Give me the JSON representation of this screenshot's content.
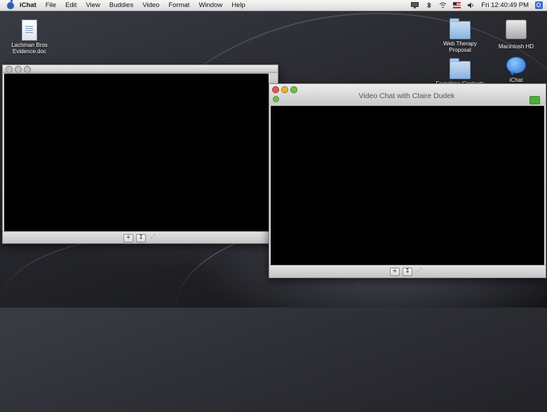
{
  "menubar": {
    "app_name": "iChat",
    "items": [
      "File",
      "Edit",
      "View",
      "Buddies",
      "Video",
      "Format",
      "Window",
      "Help"
    ],
    "clock": "Fri 12:40:49 PM"
  },
  "desktop": {
    "icons": [
      {
        "label": "Lachman Bros Evidence.doc",
        "icon": "document-icon"
      },
      {
        "label": "Web Therapy Proposal",
        "icon": "folder-icon"
      },
      {
        "label": "Macintosh HD",
        "icon": "hard-drive-icon"
      },
      {
        "label": "Franchise Contacts",
        "icon": "folder-icon"
      },
      {
        "label": "iChat",
        "icon": "ichat-icon"
      }
    ]
  },
  "windows": {
    "preview": {
      "title": ""
    },
    "chat": {
      "title": "Video Chat with Claire Dudek"
    }
  },
  "controls": {
    "add": "+",
    "mute": "↕",
    "fullscreen": "⤢"
  },
  "colors": {
    "accent": "#3b6fd1",
    "status_green": "#6ec04b",
    "close_red": "#e0584e"
  }
}
